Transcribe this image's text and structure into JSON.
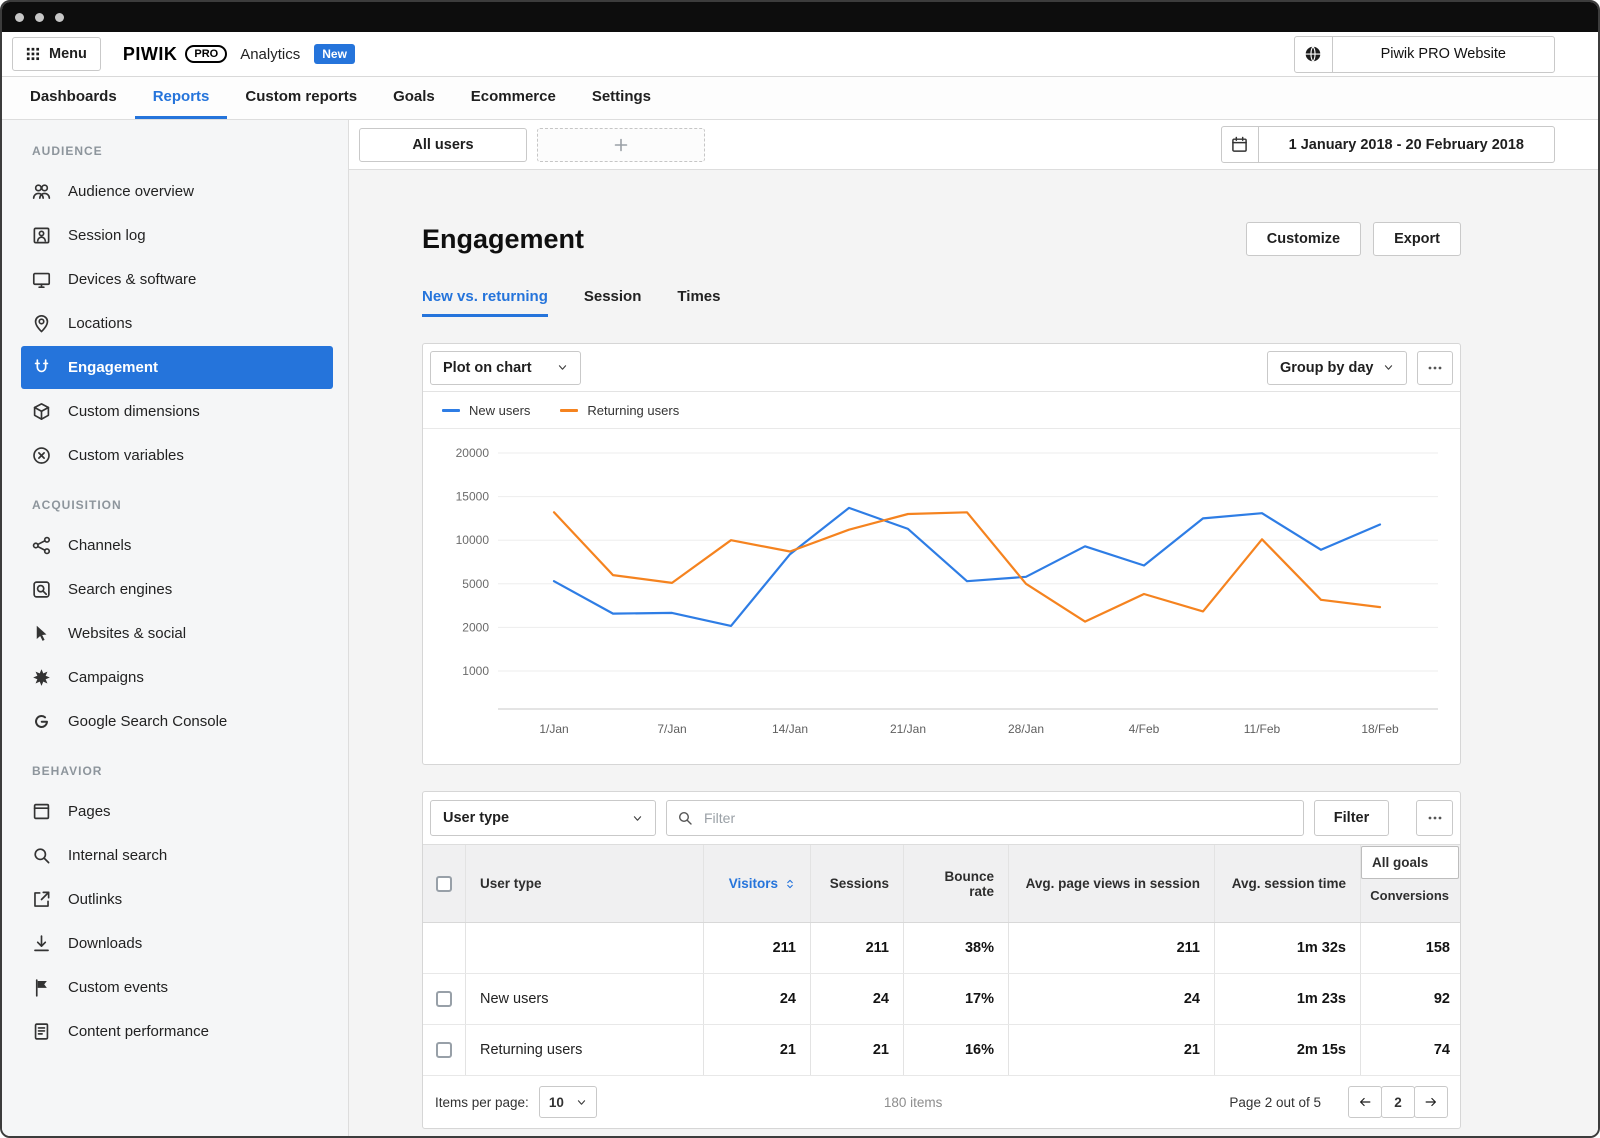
{
  "colors": {
    "accent": "#2574db",
    "chart_blue": "#2e7de5",
    "chart_orange": "#f5831f"
  },
  "header": {
    "menu_label": "Menu",
    "menu_icon": "grid-icon",
    "brand": "PIWIK",
    "brand_badge": "PRO",
    "product": "Analytics",
    "new_badge": "New",
    "site_icon": "globe-icon",
    "site_name": "Piwik PRO Website"
  },
  "nav": {
    "tabs": [
      {
        "label": "Dashboards",
        "active": false
      },
      {
        "label": "Reports",
        "active": true
      },
      {
        "label": "Custom reports",
        "active": false
      },
      {
        "label": "Goals",
        "active": false
      },
      {
        "label": "Ecommerce",
        "active": false
      },
      {
        "label": "Settings",
        "active": false
      }
    ]
  },
  "sidebar": {
    "sections": [
      {
        "label": "AUDIENCE",
        "items": [
          {
            "label": "Audience overview",
            "icon": "people-icon",
            "active": false
          },
          {
            "label": "Session log",
            "icon": "session-log-icon",
            "active": false
          },
          {
            "label": "Devices & software",
            "icon": "devices-icon",
            "active": false
          },
          {
            "label": "Locations",
            "icon": "location-icon",
            "active": false
          },
          {
            "label": "Engagement",
            "icon": "engagement-icon",
            "active": true
          },
          {
            "label": "Custom dimensions",
            "icon": "cube-icon",
            "active": false
          },
          {
            "label": "Custom variables",
            "icon": "variable-icon",
            "active": false
          }
        ]
      },
      {
        "label": "ACQUISITION",
        "items": [
          {
            "label": "Channels",
            "icon": "channels-icon",
            "active": false
          },
          {
            "label": "Search engines",
            "icon": "search-engine-icon",
            "active": false
          },
          {
            "label": "Websites & social",
            "icon": "cursor-icon",
            "active": false
          },
          {
            "label": "Campaigns",
            "icon": "burst-icon",
            "active": false
          },
          {
            "label": "Google Search Console",
            "icon": "google-icon",
            "active": false
          }
        ]
      },
      {
        "label": "BEHAVIOR",
        "items": [
          {
            "label": "Pages",
            "icon": "pages-icon",
            "active": false
          },
          {
            "label": "Internal search",
            "icon": "search-icon",
            "active": false
          },
          {
            "label": "Outlinks",
            "icon": "outlink-icon",
            "active": false
          },
          {
            "label": "Downloads",
            "icon": "download-icon",
            "active": false
          },
          {
            "label": "Custom events",
            "icon": "flag-icon",
            "active": false
          },
          {
            "label": "Content performance",
            "icon": "content-icon",
            "active": false
          }
        ]
      }
    ]
  },
  "toolbar": {
    "all_users_label": "All users",
    "add_segment_icon": "plus-icon",
    "date_icon": "calendar-icon",
    "date_range": "1 January 2018 - 20 February 2018"
  },
  "page": {
    "title": "Engagement",
    "customize_label": "Customize",
    "export_label": "Export",
    "tabs": [
      {
        "label": "New vs. returning",
        "active": true
      },
      {
        "label": "Session",
        "active": false
      },
      {
        "label": "Times",
        "active": false
      }
    ]
  },
  "chart_panel": {
    "plot_on_chart_label": "Plot on chart",
    "group_by_label": "Group by day",
    "more_icon": "ellipsis-icon"
  },
  "chart_data": {
    "type": "line",
    "x_labels_shown": [
      "1/Jan",
      "7/Jan",
      "14/Jan",
      "21/Jan",
      "28/Jan",
      "4/Feb",
      "11/Feb",
      "18/Feb"
    ],
    "x_note": "15 data points; axis labels shown on every second point",
    "y_ticks": [
      1000,
      2000,
      5000,
      10000,
      15000,
      20000
    ],
    "y_scale": "non-linear: tick marks equally spaced",
    "grid": true,
    "legend_position": "top-left",
    "series": [
      {
        "name": "New users",
        "color": "#2e7de5",
        "values": [
          5300,
          2950,
          3000,
          2100,
          8400,
          13700,
          11300,
          5300,
          5800,
          9300,
          7100,
          12500,
          13100,
          8900,
          11800
        ]
      },
      {
        "name": "Returning users",
        "color": "#f5831f",
        "values": [
          13200,
          6000,
          5100,
          10000,
          8700,
          11200,
          13000,
          13200,
          5000,
          2400,
          4300,
          3100,
          10100,
          3900,
          3400
        ]
      }
    ]
  },
  "table": {
    "dimension_select_label": "User type",
    "filter_placeholder": "Filter",
    "filter_button_label": "Filter",
    "more_icon": "ellipsis-icon",
    "columns": [
      {
        "label": "User type",
        "align": "left",
        "sortable": false
      },
      {
        "label": "Visitors",
        "align": "right",
        "sortable": true,
        "accent": true
      },
      {
        "label": "Sessions",
        "align": "right",
        "sortable": false
      },
      {
        "label": "Bounce rate",
        "align": "right",
        "sortable": false
      },
      {
        "label": "Avg. page views in session",
        "align": "right",
        "sortable": false
      },
      {
        "label": "Avg. session time",
        "align": "right",
        "sortable": false
      }
    ],
    "goals": {
      "box_label": "All goals",
      "sub_label": "Conversions"
    },
    "totals_row": {
      "label": "",
      "visitors": "211",
      "sessions": "211",
      "bounce_rate": "38%",
      "avg_page_views": "211",
      "avg_session_time": "1m 32s",
      "conversions": "158"
    },
    "rows": [
      {
        "label": "New users",
        "visitors": "24",
        "sessions": "24",
        "bounce_rate": "17%",
        "avg_page_views": "24",
        "avg_session_time": "1m 23s",
        "conversions": "92"
      },
      {
        "label": "Returning users",
        "visitors": "21",
        "sessions": "21",
        "bounce_rate": "16%",
        "avg_page_views": "21",
        "avg_session_time": "2m 15s",
        "conversions": "74"
      }
    ],
    "footer": {
      "items_per_page_label": "Items per page:",
      "items_per_page_value": "10",
      "total_items": "180 items",
      "page_label": "Page 2 out of 5",
      "current_page": "2"
    }
  }
}
